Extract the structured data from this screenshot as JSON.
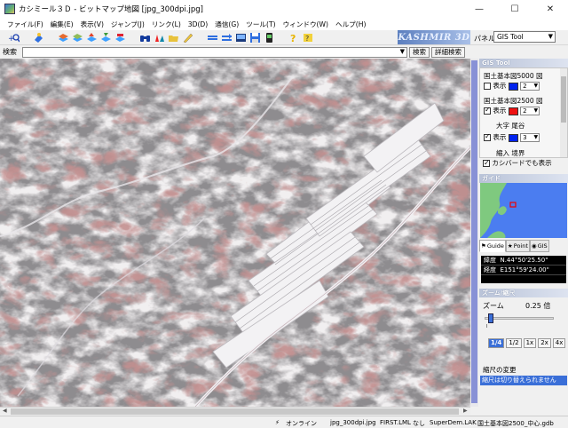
{
  "window": {
    "title": "カシミール３Ｄ - ビットマップ地図 [jpg_300dpi.jpg]",
    "minimize": "—",
    "maximize": "☐",
    "close": "✕"
  },
  "menu": [
    "ファイル(F)",
    "編集(E)",
    "表示(V)",
    "ジャンプ(J)",
    "リンク(L)",
    "3D(D)",
    "通信(G)",
    "ツール(T)",
    "ウィンドウ(W)",
    "ヘルプ(H)"
  ],
  "toolbar": {
    "icons": [
      "zoom-search-icon",
      "pin-icon",
      "add-layer-icon",
      "remove-layer-icon",
      "layer-up-icon",
      "layer-down-icon",
      "layer-edit-icon",
      "binoculars-icon",
      "waypoint-icon",
      "folder-icon",
      "ruler-icon",
      "arrow-left-icon",
      "arrow-right-icon",
      "screen-icon",
      "save-icon",
      "device-icon",
      "help-icon",
      "help-cursor-icon"
    ],
    "brand": "KASHMIR 3D",
    "panel_label": "パネル",
    "panel_value": "GIS Tool"
  },
  "search": {
    "label": "検索",
    "value": "",
    "search_button": "検索",
    "detail_button": "詳細検索"
  },
  "gis_panel": {
    "header": "GIS Tool",
    "rows": [
      {
        "name": "国土基本図5000 図",
        "show": "表示",
        "checked": false,
        "color": "#0022ee",
        "width": "2"
      },
      {
        "name": "国土基本図2500 図",
        "show": "表示",
        "checked": true,
        "color": "#ee1111",
        "width": "2"
      },
      {
        "name": "大字 尾谷",
        "show": "表示",
        "checked": true,
        "color": "#0022ee",
        "width": "3"
      },
      {
        "name": "縮入 境界",
        "show": "",
        "checked": false,
        "color": "",
        "width": ""
      }
    ],
    "kashi_label": "カシバードでも表示",
    "kashi_checked": true
  },
  "guide_panel": {
    "header": "ガイド",
    "tabs": [
      "Guide",
      "Point",
      "GIS"
    ],
    "lat_label": "緯度",
    "lat_value": "N.44°50'25.50\"",
    "lon_label": "経度",
    "lon_value": "E151°59'24.00\""
  },
  "zoom_panel": {
    "header": "ズーム/縮尺",
    "zoom_label": "ズーム",
    "zoom_value": "0.25 倍",
    "zoom_level": 0.05,
    "buttons": [
      "1/4",
      "1/2",
      "1x",
      "2x",
      "4x"
    ],
    "active_button": "1/4",
    "scale_label": "縮尺の変更",
    "scale_value": "縮尺は切り替えられません"
  },
  "status": {
    "online": "オンライン",
    "file": "jpg_300dpi.jpg",
    "lml": "FIRST.LML",
    "none": "なし",
    "dem": "SuperDem.LAK",
    "gdb": "国土基本図2500_中心.gdb"
  }
}
